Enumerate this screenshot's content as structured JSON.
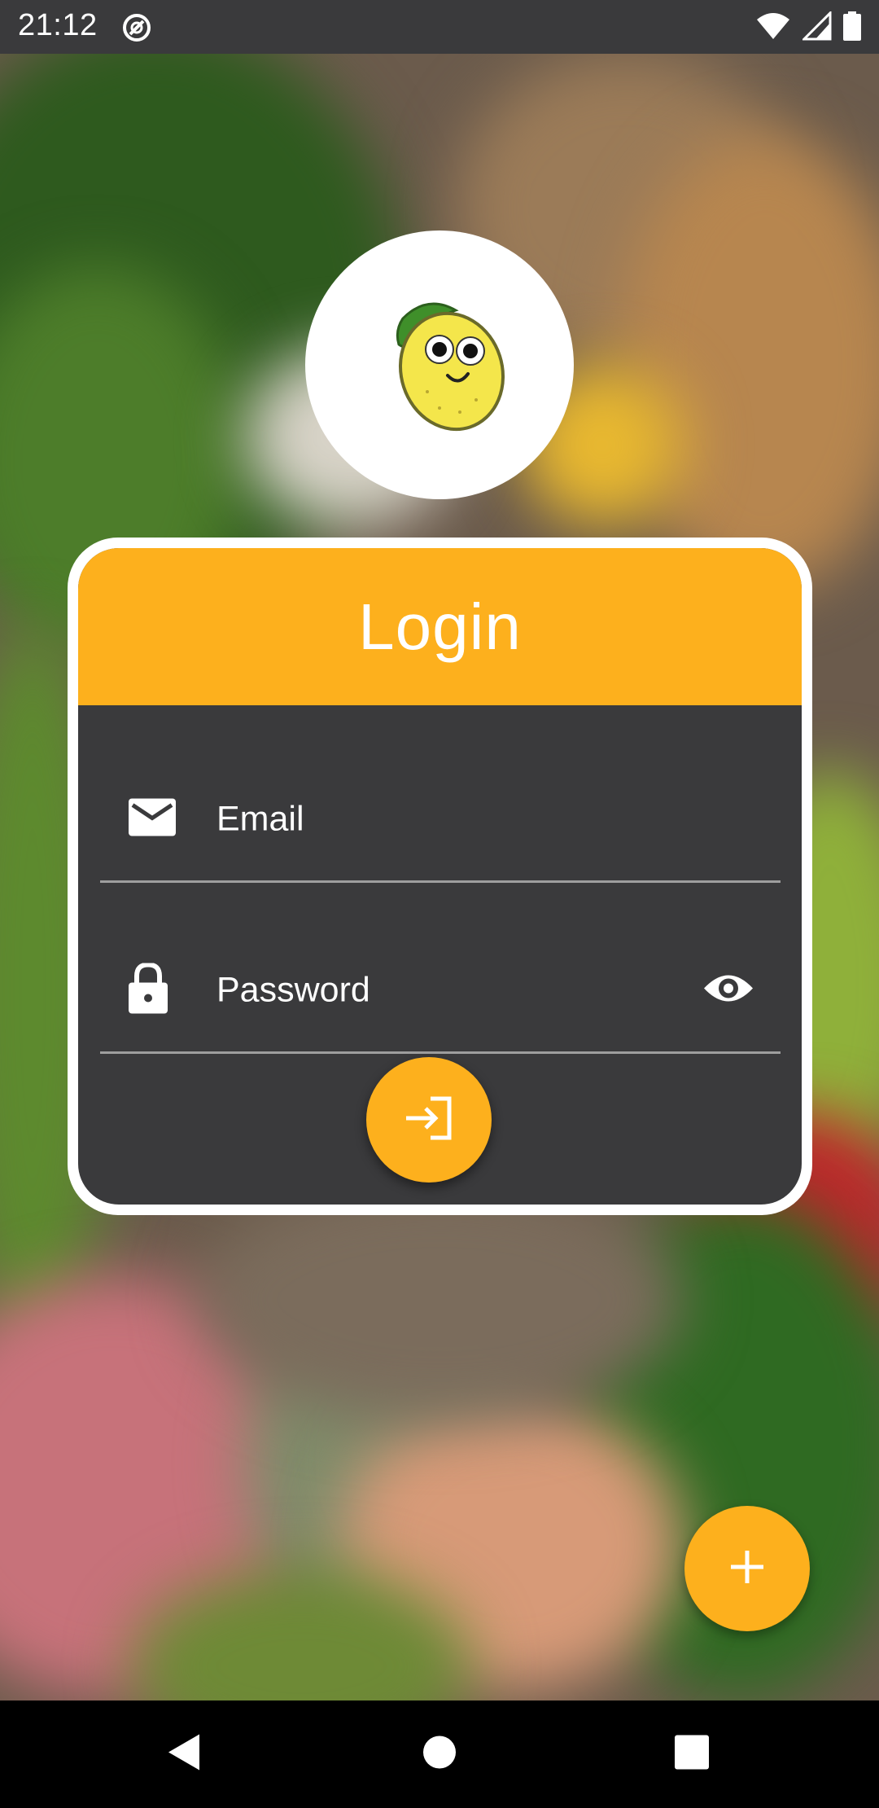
{
  "status_bar": {
    "time": "21:12",
    "icons": [
      "app-notification-icon",
      "wifi-icon",
      "signal-icon",
      "battery-icon"
    ]
  },
  "logo": {
    "icon": "lemon-mascot-icon"
  },
  "login_card": {
    "title": "Login",
    "email": {
      "placeholder": "Email",
      "icon": "email-icon"
    },
    "password": {
      "placeholder": "Password",
      "icon": "lock-icon",
      "toggle_icon": "eye-icon"
    },
    "submit_icon": "login-arrow-icon"
  },
  "fab": {
    "icon": "plus-icon"
  },
  "nav_bar": {
    "buttons": [
      "back",
      "home",
      "recents"
    ]
  },
  "colors": {
    "accent": "#fdb01d",
    "card_background": "#3a3a3c",
    "card_border": "#ffffff",
    "status_bar": "#3a3a3c"
  }
}
